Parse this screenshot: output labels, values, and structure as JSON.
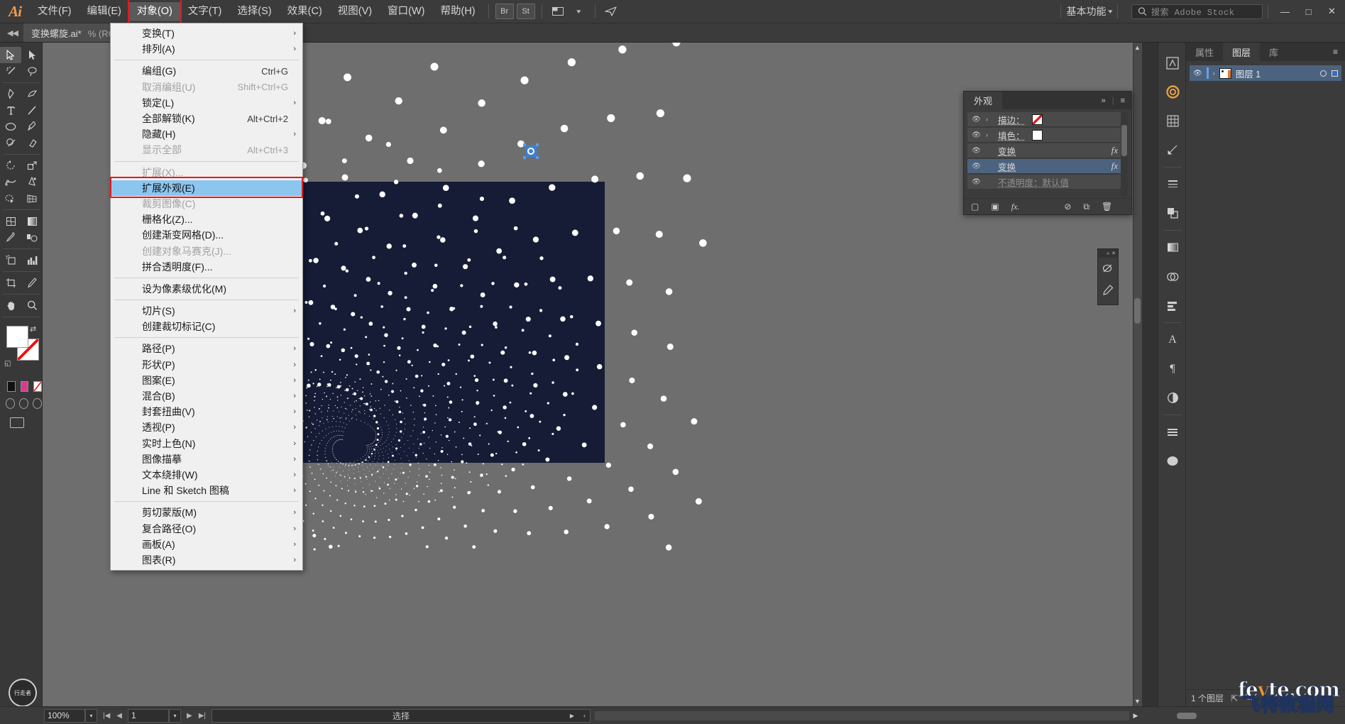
{
  "app": {
    "logo": "Ai",
    "menus": [
      {
        "label": "文件(F)",
        "active": false
      },
      {
        "label": "编辑(E)",
        "active": false
      },
      {
        "label": "对象(O)",
        "active": true
      },
      {
        "label": "文字(T)",
        "active": false
      },
      {
        "label": "选择(S)",
        "active": false
      },
      {
        "label": "效果(C)",
        "active": false
      },
      {
        "label": "视图(V)",
        "active": false
      },
      {
        "label": "窗口(W)",
        "active": false
      },
      {
        "label": "帮助(H)",
        "active": false
      }
    ],
    "bridge_label": "Br",
    "stock_label": "St",
    "workspace": "基本功能",
    "search_placeholder": "搜索 Adobe Stock",
    "window_min": "—",
    "window_max": "□",
    "window_close": "✕"
  },
  "doctab": {
    "name": "变换螺旋.ai*",
    "zoom_info": "% (RGB/GPU 预览)",
    "close": "✕"
  },
  "dropdown": {
    "title": "对象(O)",
    "items": [
      {
        "label": "变换(T)",
        "accel": "",
        "submenu": true,
        "disabled": false,
        "hl": false
      },
      {
        "label": "排列(A)",
        "accel": "",
        "submenu": true,
        "disabled": false,
        "hl": false
      },
      {
        "sep": true
      },
      {
        "label": "编组(G)",
        "accel": "Ctrl+G",
        "submenu": false,
        "disabled": false,
        "hl": false
      },
      {
        "label": "取消编组(U)",
        "accel": "Shift+Ctrl+G",
        "submenu": false,
        "disabled": true,
        "hl": false
      },
      {
        "label": "锁定(L)",
        "accel": "",
        "submenu": true,
        "disabled": false,
        "hl": false
      },
      {
        "label": "全部解锁(K)",
        "accel": "Alt+Ctrl+2",
        "submenu": false,
        "disabled": false,
        "hl": false
      },
      {
        "label": "隐藏(H)",
        "accel": "",
        "submenu": true,
        "disabled": false,
        "hl": false
      },
      {
        "label": "显示全部",
        "accel": "Alt+Ctrl+3",
        "submenu": false,
        "disabled": true,
        "hl": false
      },
      {
        "sep": true
      },
      {
        "label": "扩展(X)...",
        "accel": "",
        "submenu": false,
        "disabled": true,
        "hl": false
      },
      {
        "label": "扩展外观(E)",
        "accel": "",
        "submenu": false,
        "disabled": false,
        "hl": true
      },
      {
        "label": "裁剪图像(C)",
        "accel": "",
        "submenu": false,
        "disabled": true,
        "hl": false
      },
      {
        "label": "栅格化(Z)...",
        "accel": "",
        "submenu": false,
        "disabled": false,
        "hl": false
      },
      {
        "label": "创建渐变网格(D)...",
        "accel": "",
        "submenu": false,
        "disabled": false,
        "hl": false
      },
      {
        "label": "创建对象马赛克(J)...",
        "accel": "",
        "submenu": false,
        "disabled": true,
        "hl": false
      },
      {
        "label": "拼合透明度(F)...",
        "accel": "",
        "submenu": false,
        "disabled": false,
        "hl": false
      },
      {
        "sep": true
      },
      {
        "label": "设为像素级优化(M)",
        "accel": "",
        "submenu": false,
        "disabled": false,
        "hl": false
      },
      {
        "sep": true
      },
      {
        "label": "切片(S)",
        "accel": "",
        "submenu": true,
        "disabled": false,
        "hl": false
      },
      {
        "label": "创建裁切标记(C)",
        "accel": "",
        "submenu": false,
        "disabled": false,
        "hl": false
      },
      {
        "sep": true
      },
      {
        "label": "路径(P)",
        "accel": "",
        "submenu": true,
        "disabled": false,
        "hl": false
      },
      {
        "label": "形状(P)",
        "accel": "",
        "submenu": true,
        "disabled": false,
        "hl": false
      },
      {
        "label": "图案(E)",
        "accel": "",
        "submenu": true,
        "disabled": false,
        "hl": false
      },
      {
        "label": "混合(B)",
        "accel": "",
        "submenu": true,
        "disabled": false,
        "hl": false
      },
      {
        "label": "封套扭曲(V)",
        "accel": "",
        "submenu": true,
        "disabled": false,
        "hl": false
      },
      {
        "label": "透视(P)",
        "accel": "",
        "submenu": true,
        "disabled": false,
        "hl": false
      },
      {
        "label": "实时上色(N)",
        "accel": "",
        "submenu": true,
        "disabled": false,
        "hl": false
      },
      {
        "label": "图像描摹",
        "accel": "",
        "submenu": true,
        "disabled": false,
        "hl": false
      },
      {
        "label": "文本绕排(W)",
        "accel": "",
        "submenu": true,
        "disabled": false,
        "hl": false
      },
      {
        "label": "Line 和 Sketch 图稿",
        "accel": "",
        "submenu": true,
        "disabled": false,
        "hl": false
      },
      {
        "sep": true
      },
      {
        "label": "剪切蒙版(M)",
        "accel": "",
        "submenu": true,
        "disabled": false,
        "hl": false
      },
      {
        "label": "复合路径(O)",
        "accel": "",
        "submenu": true,
        "disabled": false,
        "hl": false
      },
      {
        "label": "画板(A)",
        "accel": "",
        "submenu": true,
        "disabled": false,
        "hl": false
      },
      {
        "label": "图表(R)",
        "accel": "",
        "submenu": true,
        "disabled": false,
        "hl": false
      }
    ]
  },
  "appearance_panel": {
    "tab": "外观",
    "collapse": "»",
    "menu": "≡",
    "rows": [
      {
        "label": "描边：",
        "type": "stroke",
        "expand": true,
        "fx": false,
        "selected": false,
        "dim": false
      },
      {
        "label": "填色：",
        "type": "fill",
        "expand": true,
        "fx": false,
        "selected": false,
        "dim": false
      },
      {
        "label": "变换",
        "type": "effect",
        "expand": false,
        "fx": true,
        "selected": false,
        "dim": false
      },
      {
        "label": "变换",
        "type": "effect",
        "expand": false,
        "fx": true,
        "selected": true,
        "dim": false
      },
      {
        "label": "不透明度：默认值",
        "type": "opacity",
        "expand": false,
        "fx": false,
        "selected": false,
        "dim": true
      }
    ],
    "footer_icons": [
      "add-new-stroke",
      "add-new-fill",
      "add-new-effect",
      "clear-appearance",
      "duplicate-item",
      "delete-item"
    ]
  },
  "right_panel": {
    "tabs": [
      {
        "label": "属性",
        "active": false
      },
      {
        "label": "图层",
        "active": true
      },
      {
        "label": "库",
        "active": false
      }
    ],
    "menu_icon": "≡",
    "layers": [
      {
        "name": "图层 1",
        "visible": true,
        "selected": true
      }
    ],
    "footer": {
      "count": "1 个图层",
      "locate_icon": "locate-object-icon",
      "search_icon": "search-icon"
    }
  },
  "statusbar": {
    "zoom": "100%",
    "page": "1",
    "status_text": "选择",
    "nav_first": "|◀",
    "nav_prev": "◀",
    "nav_next": "▶",
    "nav_last": "▶|"
  },
  "watermark": {
    "line1_a": "fe",
    "line1_b": "v",
    "line1_c": "te.com",
    "line2": "飞特教程网"
  },
  "toolbar": {
    "tools": [
      "selection-tool",
      "direct-selection-tool",
      "magic-wand-tool",
      "lasso-tool",
      "pen-tool",
      "curvature-tool",
      "type-tool",
      "line-segment-tool",
      "ellipse-tool",
      "paintbrush-tool",
      "shaper-tool",
      "eraser-tool",
      "rotate-tool",
      "scale-tool",
      "width-tool",
      "free-transform-tool",
      "shape-builder-tool",
      "perspective-grid-tool",
      "mesh-tool",
      "gradient-tool",
      "eyedropper-tool",
      "blend-tool",
      "symbol-sprayer-tool",
      "column-graph-tool",
      "artboard-tool",
      "slice-tool",
      "hand-tool",
      "zoom-tool"
    ],
    "fill_color": "#ffffff",
    "stroke_color": "#ffffff",
    "badge_text": "行走者"
  },
  "artwork": {
    "background": "#161b36",
    "dot_color": "#ffffff",
    "selection_color": "#3d7fd1"
  }
}
